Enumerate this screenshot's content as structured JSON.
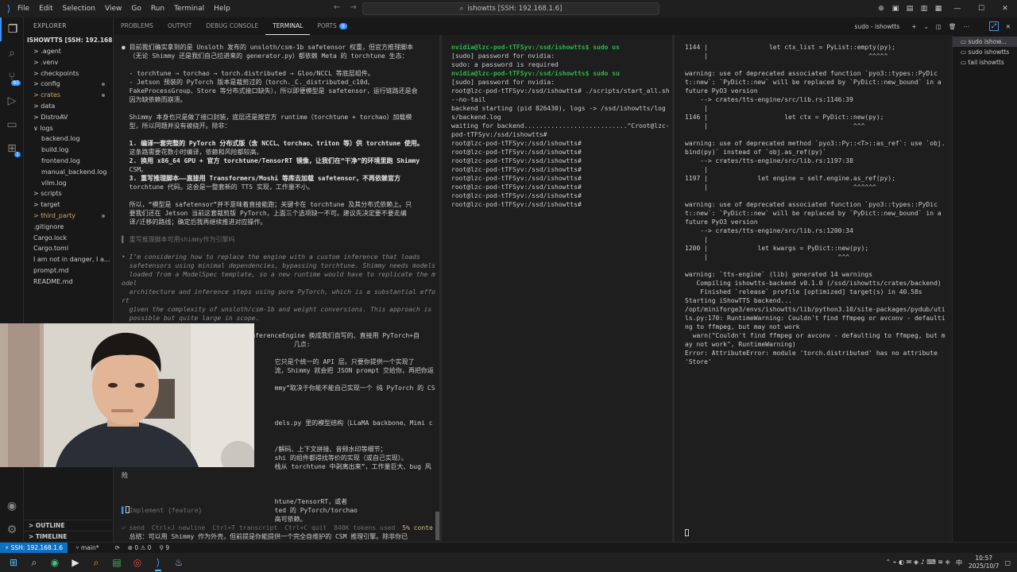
{
  "titlebar": {
    "menus": [
      "File",
      "Edit",
      "Selection",
      "View",
      "Go",
      "Run",
      "Terminal",
      "Help"
    ],
    "search": "ishowtts [SSH: 192.168.1.6]"
  },
  "explorer": {
    "header": "EXPLORER",
    "project": "ISHOWTTS [SSH: 192.168.1.6]",
    "items": [
      {
        "label": "> .agent",
        "indent": 0
      },
      {
        "label": "> .venv",
        "indent": 0
      },
      {
        "label": "> checkpoints",
        "indent": 0
      },
      {
        "label": "> config",
        "indent": 0,
        "dot": true
      },
      {
        "label": "> crates",
        "indent": 0,
        "dot": true,
        "orange": true
      },
      {
        "label": "> data",
        "indent": 0
      },
      {
        "label": "> DistroAV",
        "indent": 0
      },
      {
        "label": "∨ logs",
        "indent": 0
      },
      {
        "label": "backend.log",
        "indent": 1
      },
      {
        "label": "build.log",
        "indent": 1
      },
      {
        "label": "frontend.log",
        "indent": 1
      },
      {
        "label": "manual_backend.log",
        "indent": 1
      },
      {
        "label": "vllm.log",
        "indent": 1
      },
      {
        "label": "> scripts",
        "indent": 0
      },
      {
        "label": "> target",
        "indent": 0
      },
      {
        "label": "> third_party",
        "indent": 0,
        "dot": true,
        "orange": true
      },
      {
        "label": ".gitignore",
        "indent": 0
      },
      {
        "label": "Cargo.lock",
        "indent": 0
      },
      {
        "label": "Cargo.toml",
        "indent": 0
      },
      {
        "label": "I am not in danger, I a...",
        "indent": 0
      },
      {
        "label": "prompt.md",
        "indent": 0
      },
      {
        "label": "README.md",
        "indent": 0
      }
    ],
    "outline": "> OUTLINE",
    "timeline": "> TIMELINE"
  },
  "panel": {
    "tabs": [
      "PROBLEMS",
      "OUTPUT",
      "DEBUG CONSOLE",
      "TERMINAL",
      "PORTS"
    ],
    "ports_count": "9",
    "active": "TERMINAL",
    "terminal_name": "sudo - ishowtts"
  },
  "paneA": {
    "lines": [
      "● 目前我们确实拿到的是 Unsloth 发布的 unsloth/csm-1b safetensor 权重，但官方推理脚本",
      "  （无论 Shimmy 还是我们自己拉进来的 generator.py）都依赖 Meta 的 torchtune 生态：",
      "",
      "  - torchtune → torchao → torch.distributed → Gloo/NCCL 等底层组件。",
      "  - Jetson 预装的 PyTorch 版本是裁剪过的（torch._C._distributed_c10d、",
      "  FakeProcessGroup、Store 等分布式接口缺失），所以即便模型是 safetensor，运行链路还是会",
      "  因为缺依赖而崩溃。",
      "",
      "  Shimmy 本身也只是做了接口封装，底层还是按官方 runtime（torchtune + torchao）加载模",
      "  型，所以同题并没有被绕开。除非：",
      "",
      "  1. 编译一套完整的 PyTorch 分布式版（含 NCCL、torchao、triton 等）供 torchtune 使用。",
      "  这条路需要花数小时编译，依赖和风险都较高。",
      "  2. 换用 x86_64 GPU + 官方 torchtune/TensorRT 镜像，让我们在“干净”的环境里跑 Shimmy",
      "  CSM。",
      "  3. 重写推理脚本——直接用 Transformers/Moshi 等库去加载 safetensor，不再依赖官方",
      "  torchtune 代码。这会是一整套新的 TTS 实现，工作量不小。",
      "",
      "  所以，“模型是 safetensor”并不意味着直接能跑；关键卡在 torchtune 及其分布式依赖上。只",
      "  要我们还在 Jetson 当前这套裁剪版 PyTorch，上面三个选项缺一不可。建议先决定要不要走编",
      "  译/迁移的路线；确定后我再继续推进对应操作。",
      "",
      "▌ 重写推理脚本可用shimmy作为引擎吗",
      "",
      "• I’m considering how to replace the engine with a custom inference that loads",
      "  safetensors using minimal dependencies, bypassing torchtune. Shimmy needs models",
      "  loaded from a ModelSpec template, so a new runtime would have to replicate the model",
      "  architecture and inference steps using pure PyTorch, which is a substantial effort",
      "  given the complexity of unsloth/csm-1b and weight conversions. This approach is",
      "  possible but quite large in scope.",
      "",
      "> 理论上可以——你完全可以把 Shimmy 的 InferenceEngine 换成我们自写的、直接用 PyTorch+自",
      "                                             几点:",
      "",
      "                                        它只是个统一的 API 层。只要你提供一个实现了",
      "                                        流，Shimmy 就会把 JSON prompt 交给你，再把你返回的",
      "                                        mmy”取决于你能不能自己实现一个 纯 PyTorch 的 CSM",
      "",
      "",
      "                                        dels.py 里的模型结构（LLaMA backbone、Mimi codec、",
      "",
      "                                        /解码、上下文拼接、音频水印等细节；",
      "                                        shi 的组件都得找等价的实现（或自己实现）。",
      "                                        栈从 torchtune 中剥离出来”，工作量巨大、bug 风险",
      "",
      "",
      "                                        htune/TensorRT，或者",
      "                                        ted 的 PyTorch/torchao",
      "                                        高可依赖。",
      "",
      "  总结：可以用 Shimmy 作为外壳，但前提是你能提供一个完全自维护的 CSM 推理引擎。除非你已",
      "  经打算全盘重写这套网络，否则不建议走这条路。"
    ],
    "input_placeholder": "Implement {feature}",
    "status": [
      "⏎ send",
      "Ctrl+J newline",
      "Ctrl+T transcript",
      "Ctrl+C quit",
      "840K tokens used",
      "5% conte"
    ]
  },
  "paneB": {
    "lines": [
      "nvidia@lzc-pod-tTFSyv:/ssd/ishowtts$ sudo us",
      "[sudo] password for nvidia:",
      "sudo: a password is required",
      "nvidia@lzc-pod-tTFSyv:/ssd/ishowtts$ sudo su",
      "[sudo] password for nvidia:",
      "root@lzc-pod-tTFSyv:/ssd/ishowtts# ./scripts/start_all.sh --no-tail",
      "backend starting (pid 826430), logs -> /ssd/ishowtts/logs/backend.log",
      "waiting for backend...........................^Croot@lzc-pod-tTFSyv:/ssd/ishowtts#",
      "root@lzc-pod-tTFSyv:/ssd/ishowtts#",
      "root@lzc-pod-tTFSyv:/ssd/ishowtts#",
      "root@lzc-pod-tTFSyv:/ssd/ishowtts#",
      "root@lzc-pod-tTFSyv:/ssd/ishowtts#",
      "root@lzc-pod-tTFSyv:/ssd/ishowtts#",
      "root@lzc-pod-tTFSyv:/ssd/ishowtts#",
      "root@lzc-pod-tTFSyv:/ssd/ishowtts#",
      "root@lzc-pod-tTFSyv:/ssd/ishowtts# "
    ]
  },
  "paneC": {
    "lines": [
      "1144 |                let ctx_list = PyList::empty(py);",
      "     |                                          ^^^^^",
      "",
      "warning: use of deprecated associated function `pyo3::types::PyDict::new`: `PyDict::new` will be replaced by `PyDict::new_bound` in a future PyO3 version",
      "    --> crates/tts-engine/src/lib.rs:1146:39",
      "     |",
      "1146 |                    let ctx = PyDict::new(py);",
      "     |                                      ^^^",
      "",
      "warning: use of deprecated method `pyo3::Py::<T>::as_ref`: use `obj.bind(py)` instead of `obj.as_ref(py)`",
      "    --> crates/tts-engine/src/lib.rs:1197:38",
      "     |",
      "1197 |             let engine = self.engine.as_ref(py);",
      "     |                                      ^^^^^^",
      "",
      "warning: use of deprecated associated function `pyo3::types::PyDict::new`: `PyDict::new` will be replaced by `PyDict::new_bound` in a future PyO3 version",
      "    --> crates/tts-engine/src/lib.rs:1200:34",
      "     |",
      "1200 |             let kwargs = PyDict::new(py);",
      "     |                                  ^^^",
      "",
      "warning: `tts-engine` (lib) generated 14 warnings",
      "   Compiling ishowtts-backend v0.1.0 (/ssd/ishowtts/crates/backend)",
      "    Finished `release` profile [optimized] target(s) in 40.58s",
      "Starting iShowTTS backend...",
      "/opt/miniforge3/envs/ishowtts/lib/python3.10/site-packages/pydub/utils.py:170: RuntimeWarning: Couldn't find ffmpeg or avconv - defaulting to ffmpeg, but may not work",
      "  warn(\"Couldn't find ffmpeg or avconv - defaulting to ffmpeg, but may not work\", RuntimeWarning)",
      "Error: AttributeError: module 'torch.distributed' has no attribute 'Store'"
    ]
  },
  "termlist": {
    "items": [
      "sudo ishow...",
      "sudo ishowtts",
      "tail ishowtts"
    ]
  },
  "statusbar": {
    "remote": "⚡ SSH: 192.168.1.6",
    "branch": "main*",
    "sync": "⟳",
    "errors": "⊗ 0 ⚠ 0",
    "ports": "⚲ 9"
  },
  "taskbar": {
    "lang": "中",
    "time": "10:57",
    "date": "2025/10/7"
  }
}
